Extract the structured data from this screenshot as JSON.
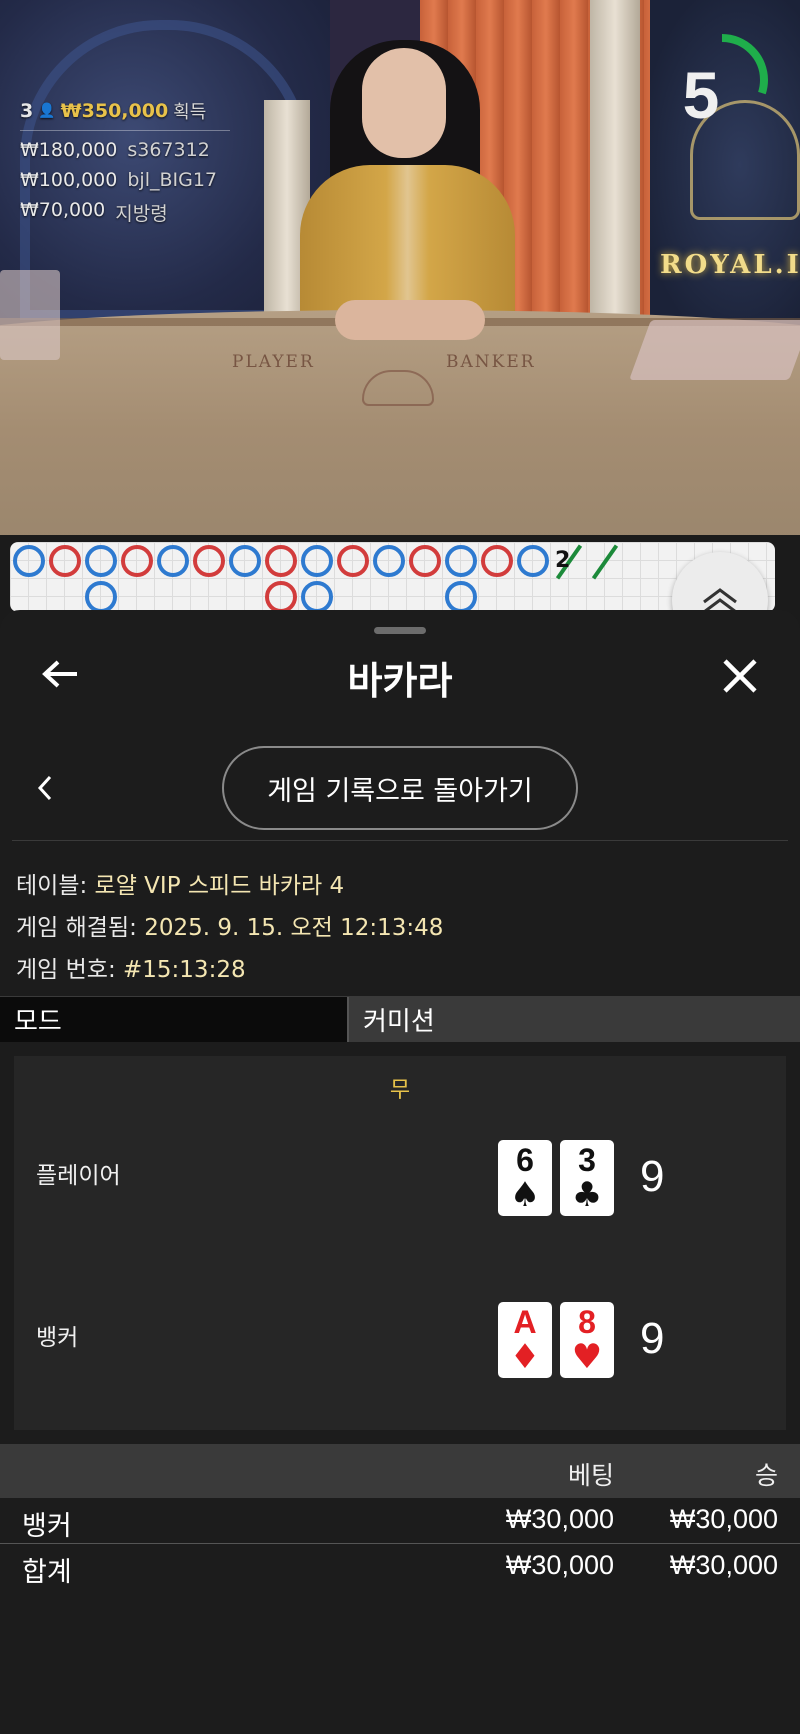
{
  "video": {
    "winners_count": "3",
    "winners_total": "₩350,000",
    "winners_label": "획득",
    "winners": [
      {
        "amount": "₩180,000",
        "name": "s367312"
      },
      {
        "amount": "₩100,000",
        "name": "bjl_BIG17"
      },
      {
        "amount": "₩70,000",
        "name": "지방령"
      }
    ],
    "timer_value": "5",
    "timer_fraction": 0.3,
    "felt_player": "PLAYER",
    "felt_banker": "BANKER",
    "brand_text": "ROYAL.I"
  },
  "roadmap": {
    "beads_row1": [
      "b",
      "p",
      "b",
      "p",
      "b",
      "p",
      "b",
      "p",
      "b",
      "p",
      "b",
      "p",
      "b",
      "p",
      "b",
      "tie",
      "tie"
    ],
    "tie_count": "2",
    "beads_row2": [
      {
        "col": 2,
        "color": "b"
      },
      {
        "col": 7,
        "color": "p"
      },
      {
        "col": 8,
        "color": "b"
      },
      {
        "col": 12,
        "color": "b"
      }
    ]
  },
  "panel": {
    "title": "바카라",
    "back_history_label": "게임 기록으로 돌아가기",
    "table_label": "테이블:",
    "table_value": "로얄 VIP 스피드 바카라 4",
    "resolved_label": "게임 해결됨:",
    "resolved_value": "2025. 9. 15. 오전 12:13:48",
    "game_no_label": "게임 번호:",
    "game_no_value": "#15:13:28",
    "mode_label": "모드",
    "mode_value": "커미션",
    "outcome": "무",
    "player": {
      "label": "플레이어",
      "cards": [
        {
          "rank": "6",
          "suit": "♠",
          "color": "black"
        },
        {
          "rank": "3",
          "suit": "♣",
          "color": "black"
        }
      ],
      "score": "9"
    },
    "banker": {
      "label": "뱅커",
      "cards": [
        {
          "rank": "A",
          "suit": "♦",
          "color": "red"
        },
        {
          "rank": "8",
          "suit": "♥",
          "color": "red"
        }
      ],
      "score": "9"
    },
    "bets_header": {
      "bet": "베팅",
      "win": "승"
    },
    "bets": [
      {
        "name": "뱅커",
        "bet": "₩30,000",
        "win": "₩30,000"
      },
      {
        "name": "합계",
        "bet": "₩30,000",
        "win": "₩30,000"
      }
    ]
  }
}
